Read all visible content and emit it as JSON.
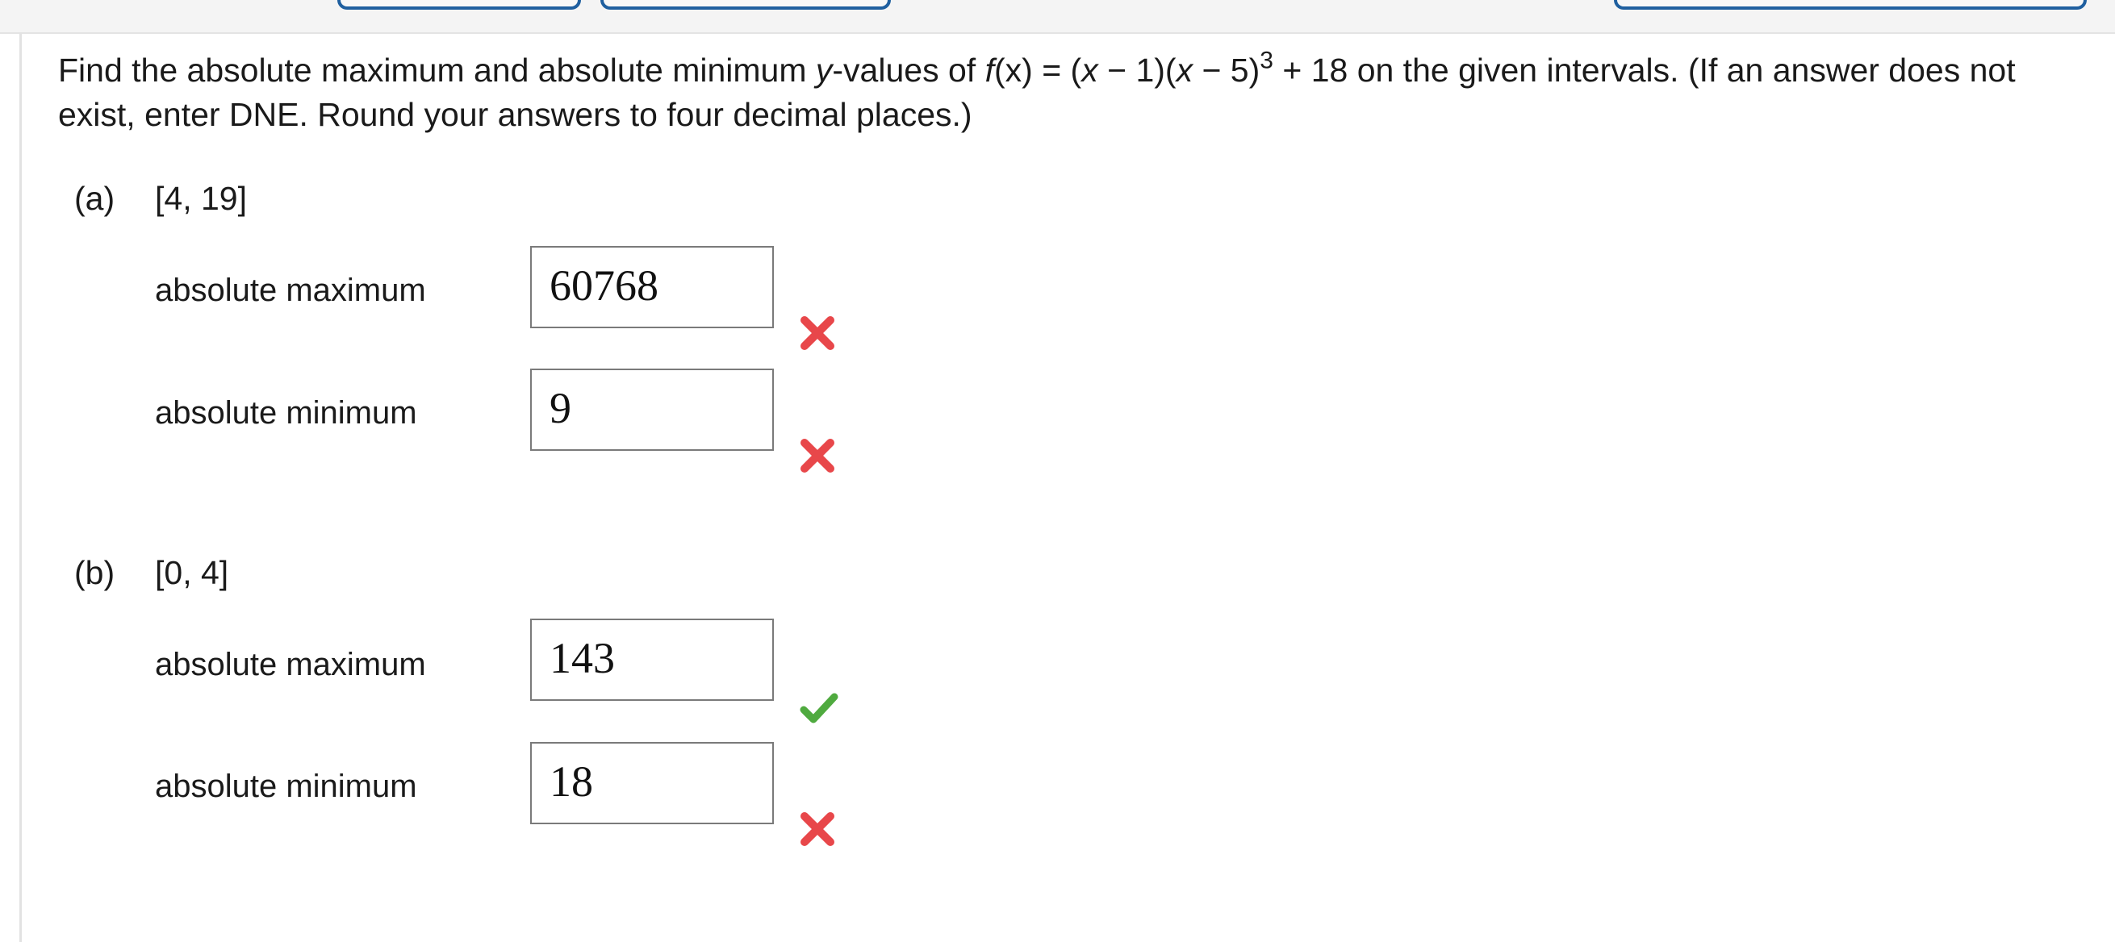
{
  "question": {
    "prefix": "Find the absolute maximum and absolute minimum",
    "y_var": "y",
    "mid": "-values of",
    "f": "f",
    "fx_arg": "(x)",
    "eq": "= (",
    "x1": "x",
    "part1": "− 1)(",
    "x2": "x",
    "part2": "− 5)",
    "exponent": "3",
    "suffix": "+ 18 on the given intervals. (If an answer does not exist, enter DNE. Round your answers to four decimal places.)"
  },
  "parts": [
    {
      "letter": "(a)",
      "interval": "[4, 19]",
      "max_label": "absolute maximum",
      "max_value": "60768",
      "max_status": "incorrect",
      "min_label": "absolute minimum",
      "min_value": "9",
      "min_status": "incorrect"
    },
    {
      "letter": "(b)",
      "interval": "[0, 4]",
      "max_label": "absolute maximum",
      "max_value": "143",
      "max_status": "correct",
      "min_label": "absolute minimum",
      "min_value": "18",
      "min_status": "incorrect"
    }
  ],
  "colors": {
    "incorrect": "#e8474a",
    "correct": "#4faa3f",
    "tab_border": "#1f5f9f"
  },
  "icons": {
    "incorrect": "cross-icon",
    "correct": "checkmark-icon"
  }
}
